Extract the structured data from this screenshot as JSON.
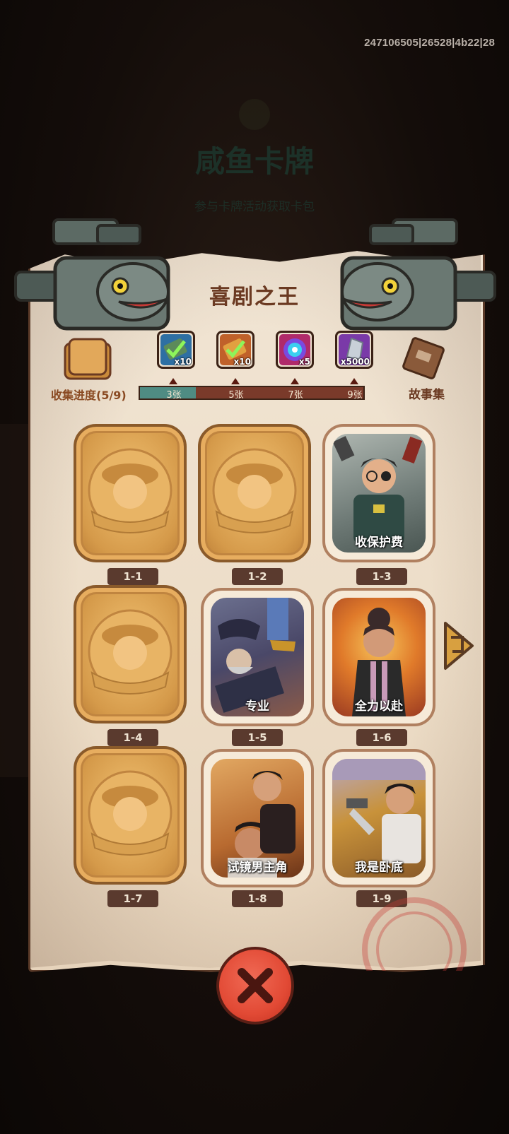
{
  "debug_id": "247106505|26528|4b22|28",
  "background": {
    "title": "咸鱼卡牌",
    "subtitle": "参与卡牌活动获取卡包"
  },
  "panel": {
    "title": "喜剧之王",
    "collect_label": "收集进度(5/9)",
    "story_label": "故事集",
    "progress_fraction": 0.25
  },
  "rewards": [
    {
      "icon": "check-ticket-blue-icon",
      "qty": "x10",
      "threshold": "3张",
      "color": "#2e6fa3"
    },
    {
      "icon": "check-ticket-orange-icon",
      "qty": "x10",
      "threshold": "5张",
      "color": "#c0612a"
    },
    {
      "icon": "swirl-orb-icon",
      "qty": "x5",
      "threshold": "7张",
      "color": "#b02a6a"
    },
    {
      "icon": "crystal-icon",
      "qty": "x5000",
      "threshold": "9张",
      "color": "#7a3aa8"
    }
  ],
  "cards": [
    {
      "num": "1-1",
      "unlocked": false,
      "title": ""
    },
    {
      "num": "1-2",
      "unlocked": false,
      "title": ""
    },
    {
      "num": "1-3",
      "unlocked": true,
      "title": "收保护费"
    },
    {
      "num": "1-4",
      "unlocked": false,
      "title": ""
    },
    {
      "num": "1-5",
      "unlocked": true,
      "title": "专业"
    },
    {
      "num": "1-6",
      "unlocked": true,
      "title": "全力以赴"
    },
    {
      "num": "1-7",
      "unlocked": false,
      "title": ""
    },
    {
      "num": "1-8",
      "unlocked": true,
      "title": "试镜男主角"
    },
    {
      "num": "1-9",
      "unlocked": true,
      "title": "我是卧底"
    }
  ],
  "colors": {
    "accent_brown": "#6b3a22",
    "card_gold": "#d59a4a",
    "progress_teal": "#4f8c83",
    "close_red": "#e24a35"
  }
}
